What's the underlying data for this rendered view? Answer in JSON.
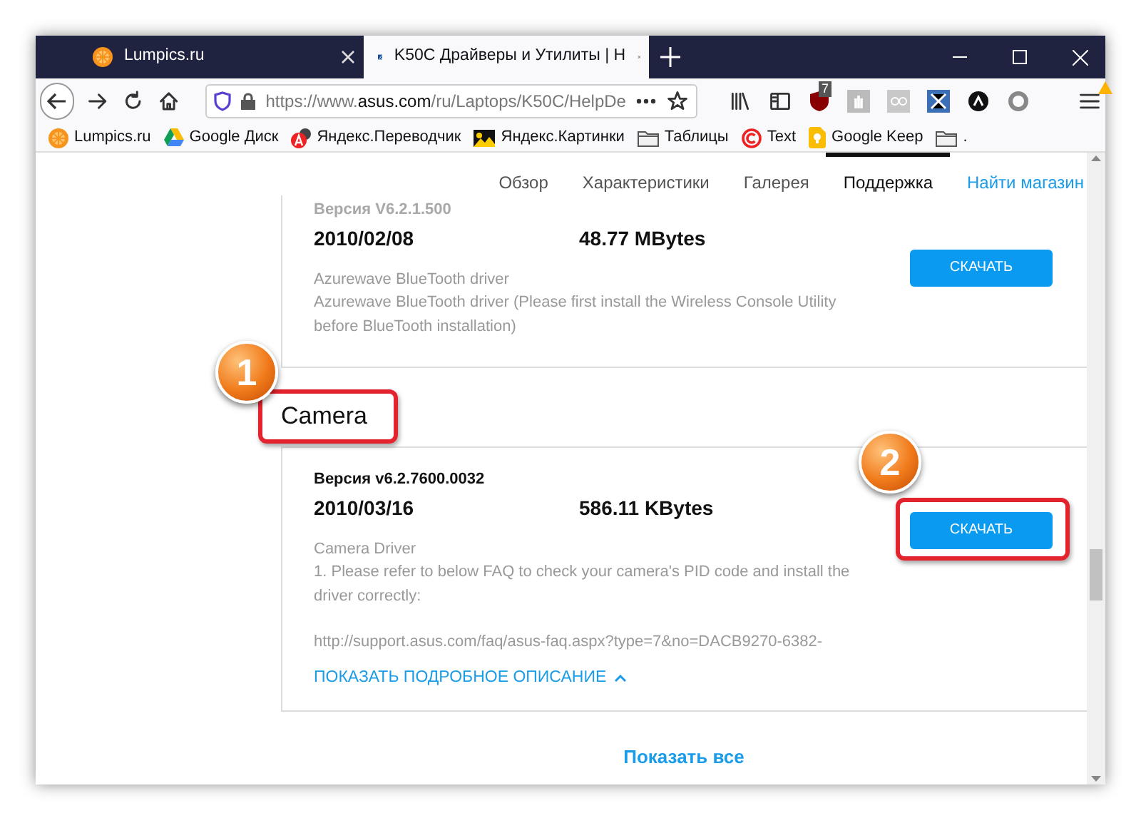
{
  "browser": {
    "tabs": [
      {
        "title": "Lumpics.ru",
        "kind": "orange",
        "selected": false
      },
      {
        "title": "K50C Драйверы и Утилиты | H",
        "kind": "asus",
        "selected": true
      }
    ],
    "url": {
      "prefix": "https://www.",
      "host": "asus.com",
      "path": "/ru/Laptops/K50C/HelpDe"
    },
    "extension_badge": "7",
    "bookmarks": [
      {
        "label": "Lumpics.ru",
        "kind": "orange"
      },
      {
        "label": "Google Диск",
        "kind": "drive"
      },
      {
        "label": "Яндекс.Переводчик",
        "kind": "translate"
      },
      {
        "label": "Яндекс.Картинки",
        "kind": "image"
      },
      {
        "label": "Таблицы",
        "kind": "folder"
      },
      {
        "label": "Text",
        "kind": "copyright"
      },
      {
        "label": "Google Keep",
        "kind": "keep"
      },
      {
        "label": ".",
        "kind": "folder"
      }
    ]
  },
  "site_nav": {
    "items": [
      {
        "label": "Обзор",
        "selected": false
      },
      {
        "label": "Характеристики",
        "selected": false
      },
      {
        "label": "Галерея",
        "selected": false
      },
      {
        "label": "Поддержка",
        "selected": true
      }
    ],
    "link": "Найти магазин"
  },
  "drivers": [
    {
      "version": "Версия V6.2.1.500",
      "version_faded": true,
      "date": "2010/02/08",
      "size": "48.77 MBytes",
      "description": [
        "Azurewave BlueTooth driver",
        "Azurewave BlueTooth driver (Please first install the Wireless Console Utility before BlueTooth installation)"
      ],
      "button": "СКАЧАТЬ"
    },
    {
      "heading": "Camera",
      "heading_marker": "1",
      "version": "Версия v6.2.7600.0032",
      "version_faded": false,
      "date": "2010/03/16",
      "size": "586.11 KBytes",
      "description": [
        "Camera Driver",
        "1. Please refer to below FAQ to check your camera's PID code and install the driver correctly:"
      ],
      "url": "http://support.asus.com/faq/asus-faq.aspx?type=7&no=DACB9270-6382-",
      "toggle": "ПОКАЗАТЬ ПОДРОБНОЕ ОПИСАНИЕ",
      "expanded": true,
      "button": "СКАЧАТЬ",
      "button_marker": "2"
    }
  ],
  "show_all": "Показать все"
}
